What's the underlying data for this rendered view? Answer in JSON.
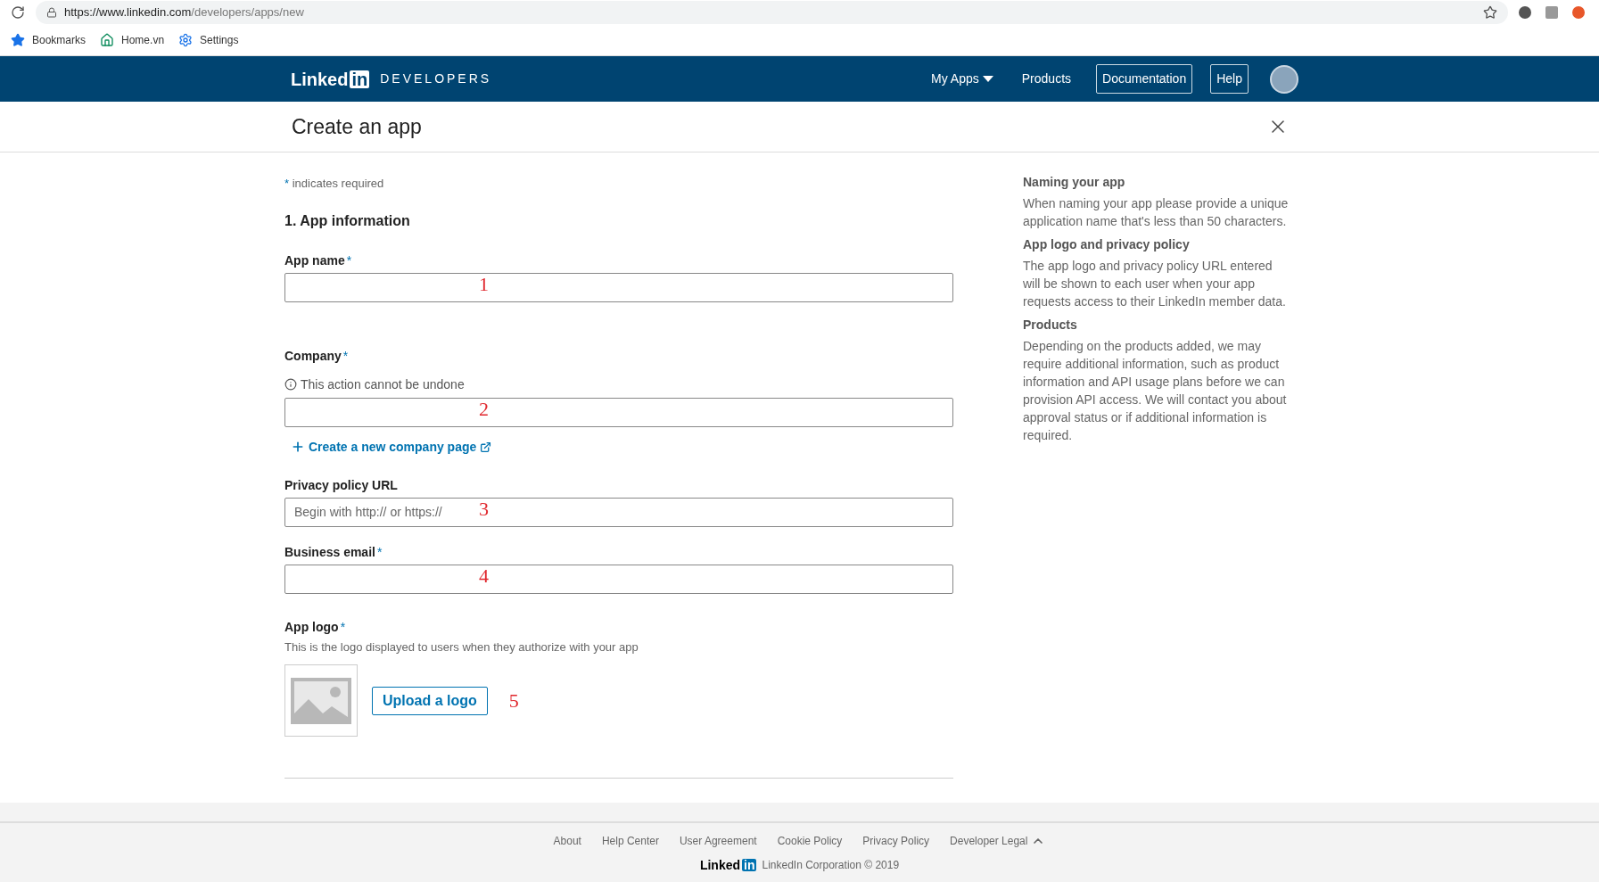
{
  "browser": {
    "url_host": "https://www.linkedin.com",
    "url_path": "/developers/apps/new",
    "bookmarks": [
      {
        "label": "Bookmarks",
        "kind": "star"
      },
      {
        "label": "Home.vn",
        "kind": "home"
      },
      {
        "label": "Settings",
        "kind": "gear"
      }
    ]
  },
  "nav": {
    "brand_word": "Linked",
    "brand_box": "in",
    "brand_suffix": "DEVELOPERS",
    "items": [
      {
        "label": "My Apps",
        "kind": "dropdown"
      },
      {
        "label": "Products",
        "kind": "link"
      },
      {
        "label": "Documentation",
        "kind": "outlined"
      },
      {
        "label": "Help",
        "kind": "outlined"
      }
    ]
  },
  "page": {
    "title": "Create an app"
  },
  "form": {
    "required_note": {
      "mark": "*",
      "text": "indicates required"
    },
    "section_title": "1. App information",
    "fields": [
      {
        "label": "App name",
        "required_mark": "*",
        "annotation": "1"
      },
      {
        "label": "Company",
        "required_mark": "*",
        "note": "This action cannot be undone",
        "annotation": "2",
        "link": "Create a new company page"
      },
      {
        "label": "Privacy policy URL",
        "placeholder": "Begin with http:// or https://",
        "annotation": "3"
      },
      {
        "label": "Business email",
        "required_mark": "*",
        "annotation": "4"
      }
    ],
    "logo": {
      "label": "App logo",
      "required_mark": "*",
      "description": "This is the logo displayed to users when they authorize with your app",
      "button": "Upload a logo",
      "annotation": "5"
    }
  },
  "sidebar": [
    {
      "heading": "Naming your app",
      "body": "When naming your app please provide a unique application name that's less than 50 characters."
    },
    {
      "heading": "App logo and privacy policy",
      "body": "The app logo and privacy policy URL entered will be shown to each user when your app requests access to their LinkedIn member data."
    },
    {
      "heading": "Products",
      "body": "Depending on the products added, we may require additional information, such as product information and API usage plans before we can provision API access. We will contact you about approval status or if additional information is required."
    }
  ],
  "footer": {
    "links": [
      {
        "label": "About",
        "kind": "link"
      },
      {
        "label": "Help Center",
        "kind": "link"
      },
      {
        "label": "User Agreement",
        "kind": "link"
      },
      {
        "label": "Cookie Policy",
        "kind": "link"
      },
      {
        "label": "Privacy Policy",
        "kind": "link"
      },
      {
        "label": "Developer Legal",
        "kind": "expand"
      }
    ],
    "brand_word": "Linked",
    "brand_box": "in",
    "copyright": "LinkedIn Corporation © 2019"
  }
}
